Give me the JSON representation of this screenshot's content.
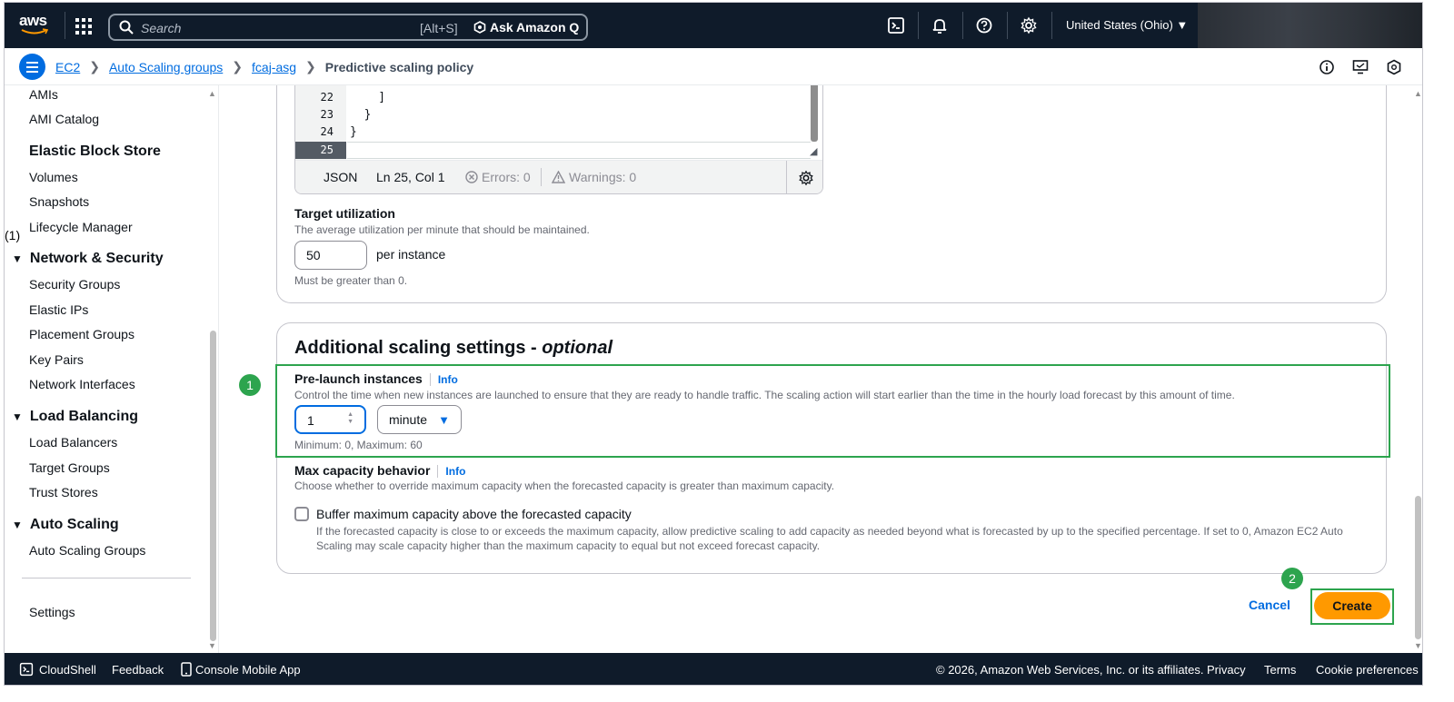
{
  "topnav": {
    "logo_text": "aws",
    "search_placeholder": "Search",
    "search_shortcut": "[Alt+S]",
    "ask_q_label": "Ask Amazon Q",
    "region": "United States (Ohio) ▼"
  },
  "breadcrumb": {
    "items": [
      "EC2",
      "Auto Scaling groups",
      "fcaj-asg"
    ],
    "current": "Predictive scaling policy"
  },
  "sidebar": {
    "annotation": "(1)",
    "items": [
      {
        "type": "item",
        "label": "AMIs"
      },
      {
        "type": "item",
        "label": "AMI Catalog"
      },
      {
        "type": "head",
        "label": "Elastic Block Store"
      },
      {
        "type": "item",
        "label": "Volumes"
      },
      {
        "type": "item",
        "label": "Snapshots"
      },
      {
        "type": "item",
        "label": "Lifecycle Manager"
      },
      {
        "type": "head",
        "label": "Network & Security"
      },
      {
        "type": "item",
        "label": "Security Groups"
      },
      {
        "type": "item",
        "label": "Elastic IPs"
      },
      {
        "type": "item",
        "label": "Placement Groups"
      },
      {
        "type": "item",
        "label": "Key Pairs"
      },
      {
        "type": "item",
        "label": "Network Interfaces"
      },
      {
        "type": "head",
        "label": "Load Balancing"
      },
      {
        "type": "item",
        "label": "Load Balancers"
      },
      {
        "type": "item",
        "label": "Target Groups"
      },
      {
        "type": "item",
        "label": "Trust Stores"
      },
      {
        "type": "head",
        "label": "Auto Scaling"
      },
      {
        "type": "item",
        "label": "Auto Scaling Groups"
      },
      {
        "type": "item",
        "label": "Settings"
      }
    ]
  },
  "editor": {
    "lines": [
      {
        "num": "22",
        "code": "    ]"
      },
      {
        "num": "23",
        "code": "  }"
      },
      {
        "num": "24",
        "code": "}"
      },
      {
        "num": "25",
        "code": ""
      }
    ],
    "language": "JSON",
    "position": "Ln 25, Col 1",
    "errors": "Errors: 0",
    "warnings": "Warnings: 0"
  },
  "target": {
    "label": "Target utilization",
    "description": "The average utilization per minute that should be maintained.",
    "value": "50",
    "suffix": "per instance",
    "hint": "Must be greater than 0."
  },
  "additional": {
    "title": "Additional scaling settings - ",
    "title_optional": "optional",
    "prelaunch_label": "Pre-launch instances",
    "info": "Info",
    "prelaunch_desc": "Control the time when new instances are launched to ensure that they are ready to handle traffic. The scaling action will start earlier than the time in the hourly load forecast by this amount of time.",
    "prelaunch_value": "1",
    "unit": "minute",
    "prelaunch_hint": "Minimum: 0, Maximum: 60",
    "maxcap_label": "Max capacity behavior",
    "maxcap_desc": "Choose whether to override maximum capacity when the forecasted capacity is greater than maximum capacity.",
    "buffer_label": "Buffer maximum capacity above the forecasted capacity",
    "buffer_desc": "If the forecasted capacity is close to or exceeds the maximum capacity, allow predictive scaling to add capacity as needed beyond what is forecasted by up to the specified percentage. If set to 0, Amazon EC2 Auto Scaling may scale capacity higher than the maximum capacity to equal but not exceed forecast capacity.",
    "buffer_checked": false
  },
  "annotations": {
    "step1": "1",
    "step2": "2"
  },
  "actions": {
    "cancel": "Cancel",
    "create": "Create"
  },
  "footer": {
    "cloudshell": "CloudShell",
    "feedback": "Feedback",
    "mobile": "Console Mobile App",
    "copyright": "© 2026, Amazon Web Services, Inc. or its affiliates.",
    "privacy": "Privacy",
    "terms": "Terms",
    "cookies": "Cookie preferences"
  },
  "colors": {
    "accent": "#006ce0",
    "primary_button": "#ff9900",
    "nav_bg": "#0f1b2a",
    "annotation": "#2da44e"
  }
}
